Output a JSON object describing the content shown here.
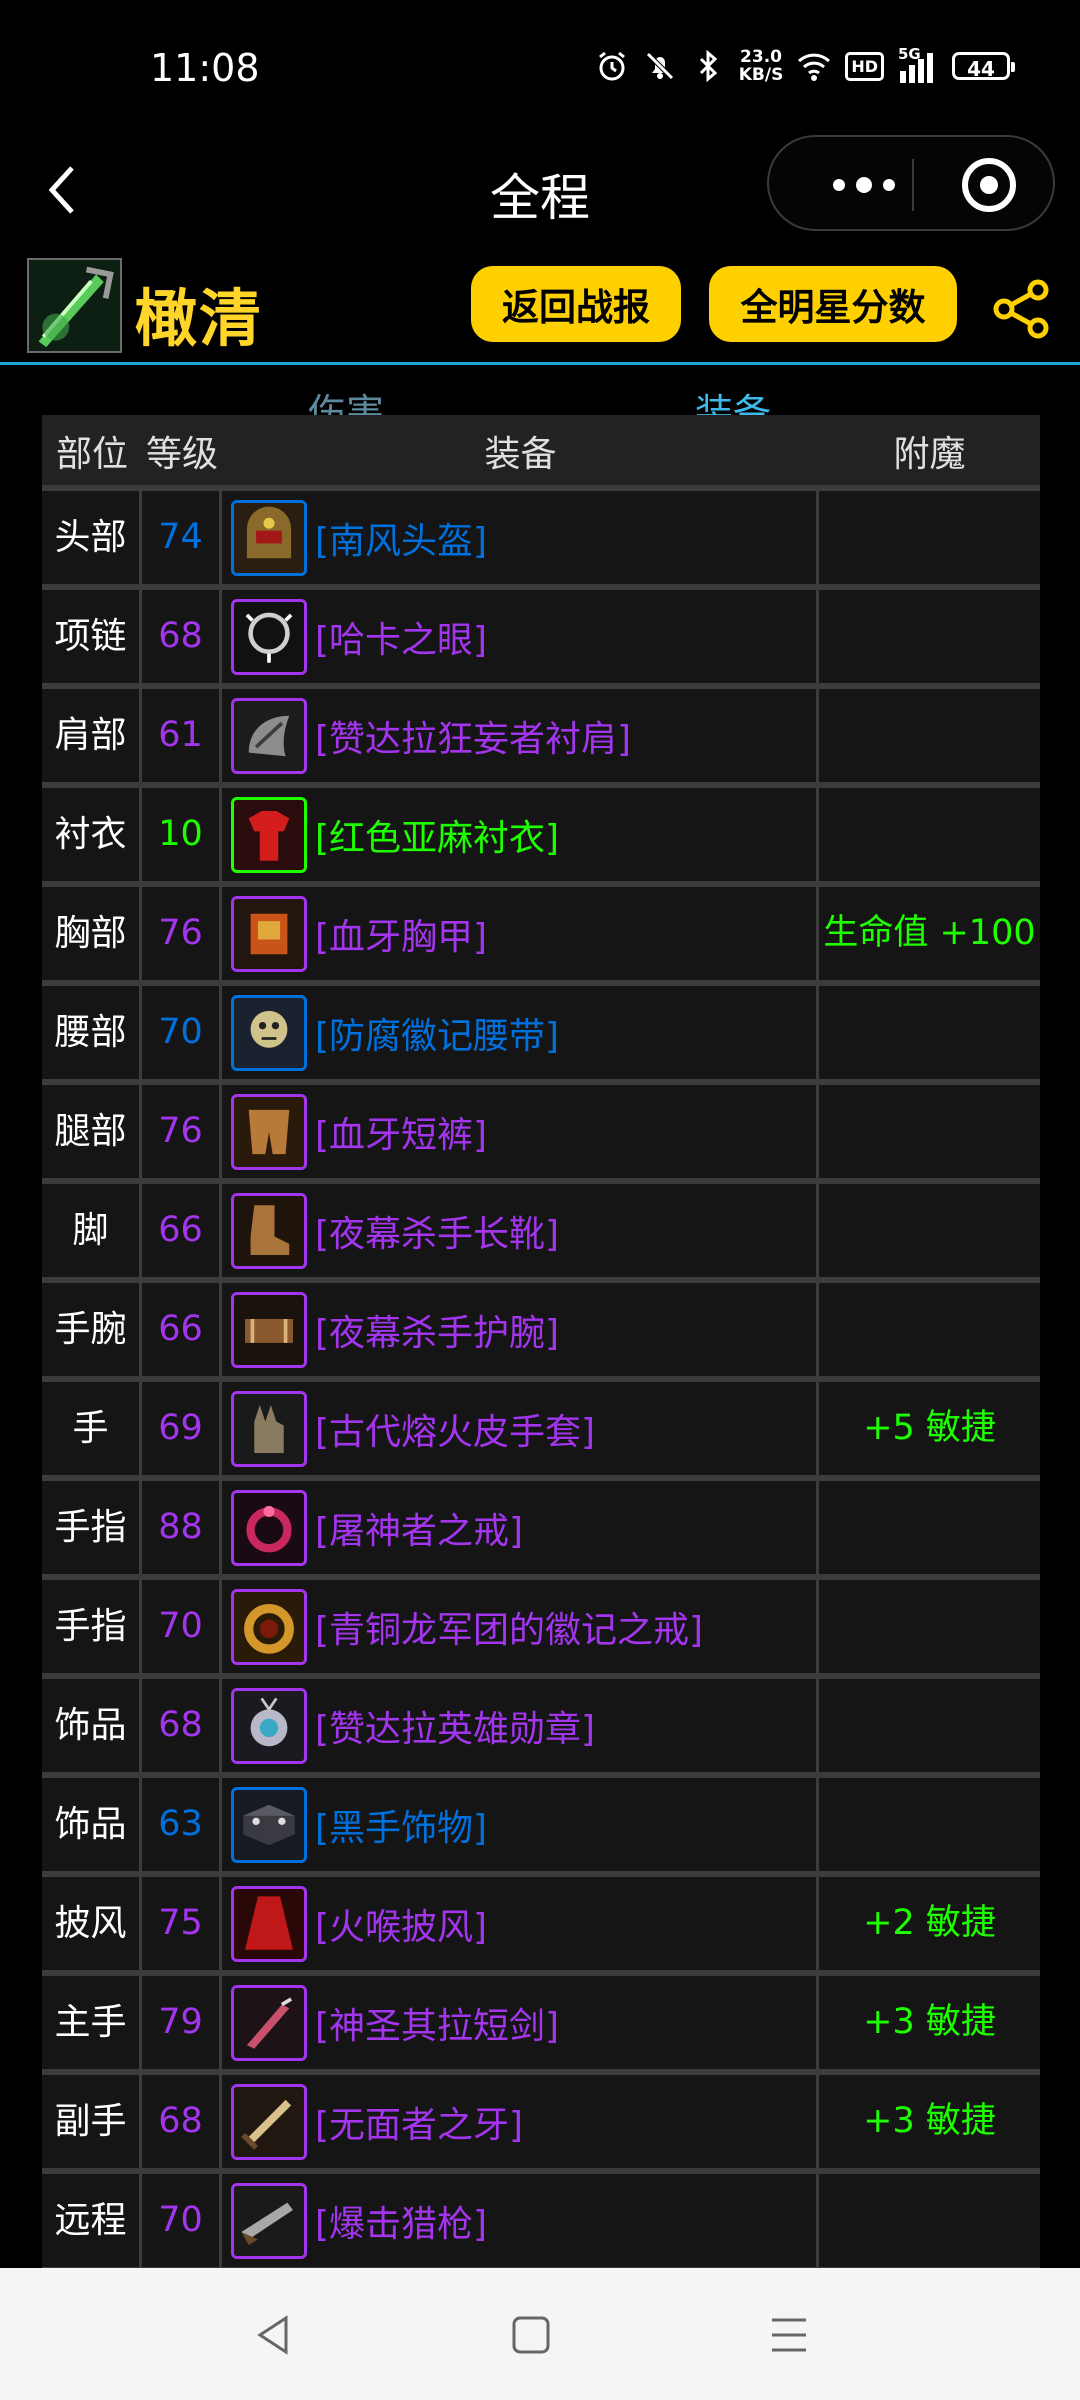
{
  "status_bar": {
    "time": "11:08",
    "net_speed_value": "23.0",
    "net_speed_unit": "KB/S",
    "hd_label": "HD",
    "signal_label": "5G",
    "battery": "44"
  },
  "nav": {
    "title": "全程"
  },
  "header": {
    "character_name": "橄清",
    "back_to_report_label": "返回战报",
    "allstar_score_label": "全明星分数"
  },
  "tabs": [
    {
      "label": "伤害",
      "active": false
    },
    {
      "label": "装备",
      "active": true
    }
  ],
  "table": {
    "columns": [
      "部位",
      "等级",
      "装备",
      "附魔"
    ],
    "rows": [
      {
        "slot": "头部",
        "level": "74",
        "item": "[南风头盔]",
        "quality": "blue",
        "icon": "helmet-icon",
        "enchant": ""
      },
      {
        "slot": "项链",
        "level": "68",
        "item": "[哈卡之眼]",
        "quality": "purple",
        "icon": "necklace-icon",
        "enchant": ""
      },
      {
        "slot": "肩部",
        "level": "61",
        "item": "[赞达拉狂妄者衬肩]",
        "quality": "purple",
        "icon": "shoulder-icon",
        "enchant": ""
      },
      {
        "slot": "衬衣",
        "level": "10",
        "item": "[红色亚麻衬衣]",
        "quality": "green",
        "icon": "shirt-icon",
        "enchant": ""
      },
      {
        "slot": "胸部",
        "level": "76",
        "item": "[血牙胸甲]",
        "quality": "purple",
        "icon": "chest-armor-icon",
        "enchant": "生命值 +100"
      },
      {
        "slot": "腰部",
        "level": "70",
        "item": "[防腐徽记腰带]",
        "quality": "blue",
        "icon": "belt-icon",
        "enchant": ""
      },
      {
        "slot": "腿部",
        "level": "76",
        "item": "[血牙短裤]",
        "quality": "purple",
        "icon": "legs-icon",
        "enchant": ""
      },
      {
        "slot": "脚",
        "level": "66",
        "item": "[夜幕杀手长靴]",
        "quality": "purple",
        "icon": "boots-icon",
        "enchant": ""
      },
      {
        "slot": "手腕",
        "level": "66",
        "item": "[夜幕杀手护腕]",
        "quality": "purple",
        "icon": "bracer-icon",
        "enchant": ""
      },
      {
        "slot": "手",
        "level": "69",
        "item": "[古代熔火皮手套]",
        "quality": "purple",
        "icon": "gloves-icon",
        "enchant": "+5 敏捷"
      },
      {
        "slot": "手指",
        "level": "88",
        "item": "[屠神者之戒]",
        "quality": "purple",
        "icon": "ring-icon",
        "enchant": ""
      },
      {
        "slot": "手指",
        "level": "70",
        "item": "[青铜龙军团的徽记之戒]",
        "quality": "purple",
        "icon": "dragon-ring-icon",
        "enchant": ""
      },
      {
        "slot": "饰品",
        "level": "68",
        "item": "[赞达拉英雄勋章]",
        "quality": "purple",
        "icon": "medal-icon",
        "enchant": ""
      },
      {
        "slot": "饰品",
        "level": "63",
        "item": "[黑手饰物]",
        "quality": "blue",
        "icon": "trinket-icon",
        "enchant": ""
      },
      {
        "slot": "披风",
        "level": "75",
        "item": "[火喉披风]",
        "quality": "purple",
        "icon": "cloak-icon",
        "enchant": "+2 敏捷"
      },
      {
        "slot": "主手",
        "level": "79",
        "item": "[神圣其拉短剑]",
        "quality": "purple",
        "icon": "dagger-icon",
        "enchant": "+3 敏捷"
      },
      {
        "slot": "副手",
        "level": "68",
        "item": "[无面者之牙]",
        "quality": "purple",
        "icon": "fang-dagger-icon",
        "enchant": "+3 敏捷"
      },
      {
        "slot": "远程",
        "level": "70",
        "item": "[爆击猎枪]",
        "quality": "purple",
        "icon": "gun-icon",
        "enchant": ""
      }
    ]
  },
  "colors": {
    "purple": "#a335ee",
    "blue": "#0070dd",
    "green": "#1eff00",
    "accent_yellow": "#ffd000",
    "tab_line": "#1aa6d6"
  }
}
